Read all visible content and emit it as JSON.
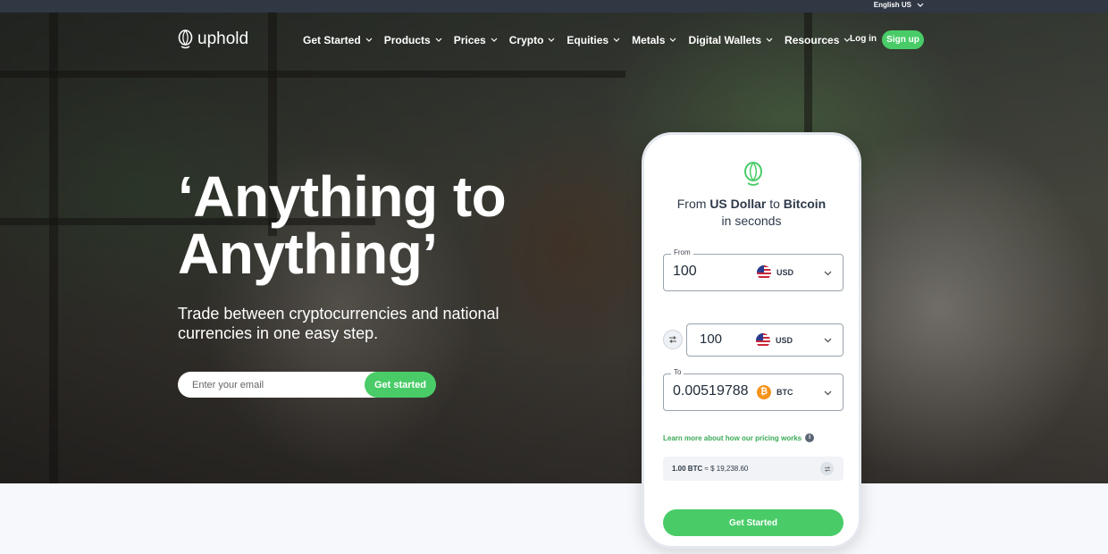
{
  "topbar": {
    "language": "English US"
  },
  "nav": {
    "logo_text": "uphold",
    "items": [
      {
        "label": "Get Started"
      },
      {
        "label": "Products"
      },
      {
        "label": "Prices"
      },
      {
        "label": "Crypto"
      },
      {
        "label": "Equities"
      },
      {
        "label": "Metals"
      },
      {
        "label": "Digital Wallets"
      },
      {
        "label": "Resources"
      }
    ],
    "login_label": "Log in",
    "signup_label": "Sign up"
  },
  "hero": {
    "headline_line1": "‘Anything to",
    "headline_line2": "Anything’",
    "subheading": "Trade between cryptocurrencies and national currencies in one easy step.",
    "email_placeholder": "Enter your email",
    "cta_label": "Get started"
  },
  "widget": {
    "title_prefix": "From",
    "title_from": "US Dollar",
    "title_mid": "to",
    "title_to": "Bitcoin",
    "title_suffix": "in seconds",
    "from_label": "From",
    "from_amount": "100",
    "from_currency": "USD",
    "swap_amount": "100",
    "swap_currency": "USD",
    "to_label": "To",
    "to_amount": "0.00519788",
    "to_currency": "BTC",
    "btc_symbol": "₿",
    "learn_more": "Learn more about how our pricing works",
    "rate_left": "1.00 BTC",
    "rate_right": "≈ $ 19,238.60",
    "button_label": "Get Started"
  },
  "colors": {
    "brand_green": "#49cc68",
    "topbar": "#2f3843"
  }
}
